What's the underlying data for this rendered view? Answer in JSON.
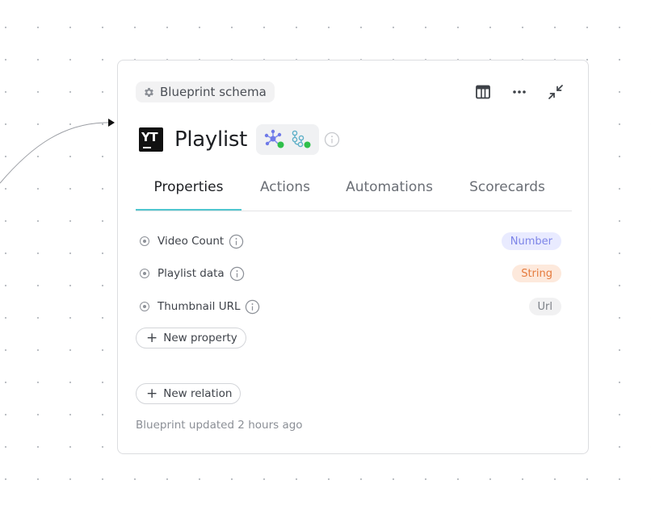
{
  "card": {
    "schema_chip": {
      "label": "Blueprint schema",
      "icon": "gear-icon"
    },
    "header_actions": [
      {
        "name": "table-view-button",
        "icon": "table-icon"
      },
      {
        "name": "more-options-button",
        "icon": "ellipsis-icon"
      },
      {
        "name": "collapse-button",
        "icon": "collapse-arrows-icon"
      }
    ],
    "logo": {
      "text": "YT",
      "icon": "youtube-logo-icon"
    },
    "title": "Playlist",
    "integrations": [
      {
        "icon": "graph-network-icon",
        "status": "active",
        "status_color": "#2fbf4a"
      },
      {
        "icon": "git-branch-icon",
        "status": "active",
        "status_color": "#2fbf4a"
      }
    ],
    "tabs": [
      "Properties",
      "Actions",
      "Automations",
      "Scorecards"
    ],
    "active_tab": "Properties",
    "properties": [
      {
        "label": "Video Count",
        "type": "Number"
      },
      {
        "label": "Playlist data",
        "type": "String"
      },
      {
        "label": "Thumbnail URL",
        "type": "Url"
      }
    ],
    "new_property_label": "New property",
    "new_relation_label": "New relation",
    "footer": "Blueprint updated 2 hours ago"
  },
  "colors": {
    "accent_tab": "#4fc6cf",
    "badge_number": "#7d85e8",
    "badge_string": "#e57a3c",
    "badge_url": "#7b7f86"
  }
}
